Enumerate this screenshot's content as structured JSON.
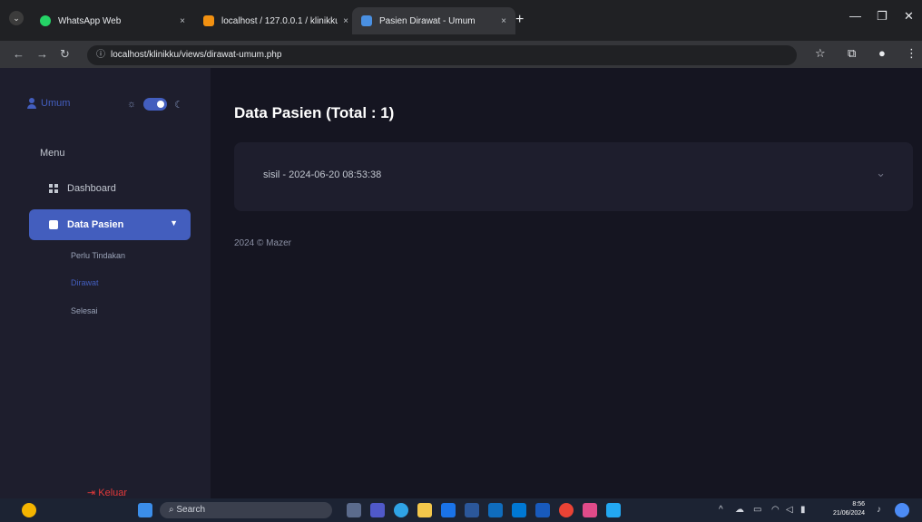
{
  "browser": {
    "tabs": [
      {
        "label": "WhatsApp Web",
        "favicon_color": "#25d366",
        "active": false
      },
      {
        "label": "localhost / 127.0.0.1 / klinikku |",
        "favicon_color": "#f29111",
        "active": false
      },
      {
        "label": "Pasien Dirawat - Umum",
        "favicon_color": "#4a90e2",
        "active": true
      }
    ],
    "close_symbol": "×",
    "new_tab_symbol": "+",
    "url": "localhost/klinikku/views/dirawat-umum.php"
  },
  "sidebar": {
    "user_label": "Umum",
    "menu_title": "Menu",
    "items": [
      {
        "label": "Dashboard",
        "icon": "grid-icon",
        "active": false
      },
      {
        "label": "Data Pasien",
        "icon": "folder-icon",
        "active": true
      }
    ],
    "subitems": [
      {
        "label": "Perlu Tindakan",
        "active": false
      },
      {
        "label": "Dirawat",
        "active": true
      },
      {
        "label": "Selesai",
        "active": false
      }
    ],
    "logout_label": "Keluar"
  },
  "main": {
    "title": "Data Pasien (Total : 1)",
    "entries": [
      "sisil - 2024-06-20 08:53:38"
    ],
    "footer": "2024 © Mazer"
  },
  "taskbar": {
    "search_label": "Search",
    "time": "8:56",
    "date": "21/06/2024"
  },
  "colors": {
    "accent": "#435ebe",
    "sidebar_bg": "#1e1e2d",
    "main_bg": "#151521",
    "logout": "#e33a3a"
  }
}
